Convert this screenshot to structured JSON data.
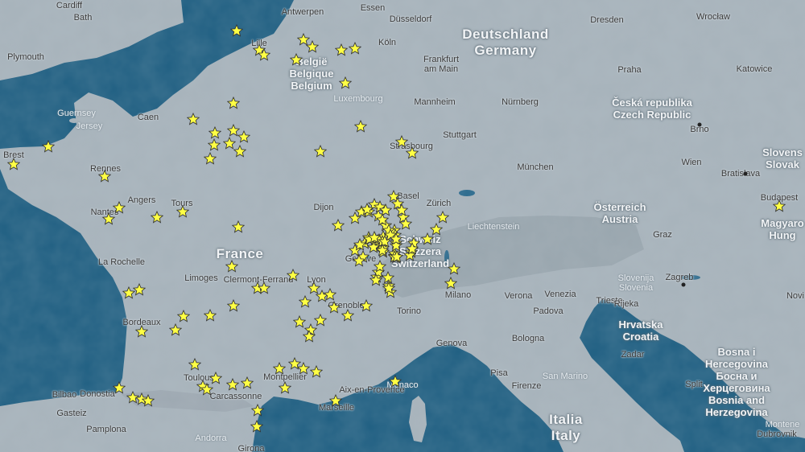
{
  "colors": {
    "sea": "#1f5f82",
    "land": "#a7b3bb",
    "marker": "#ffff44",
    "marker_stroke": "#333333"
  },
  "countries": [
    {
      "id": "germany",
      "lines": [
        "Deutschland",
        "Germany"
      ]
    },
    {
      "id": "france",
      "lines": [
        "France"
      ]
    },
    {
      "id": "belgium",
      "lines": [
        "België",
        "Belgique",
        "Belgium"
      ]
    },
    {
      "id": "czech",
      "lines": [
        "Česká republika",
        "Czech Republic"
      ]
    },
    {
      "id": "austria",
      "lines": [
        "Österreich",
        "Austria"
      ]
    },
    {
      "id": "switzerland",
      "lines": [
        "Schweiz",
        "Svizzera",
        "Switzerland"
      ]
    },
    {
      "id": "italy",
      "lines": [
        "Italia",
        "Italy"
      ]
    },
    {
      "id": "croatia",
      "lines": [
        "Hrvatska",
        "Croatia"
      ]
    },
    {
      "id": "bosnia",
      "lines": [
        "Bosna i",
        "Hercegovina",
        "Босна и",
        "Херцеговина",
        "Bosnia and",
        "Herzegovina"
      ]
    },
    {
      "id": "slovenia",
      "lines": [
        "Slovenija",
        "Slovenia"
      ]
    },
    {
      "id": "slovakia",
      "lines": [
        "Slovens",
        "Slovak"
      ]
    },
    {
      "id": "hungary",
      "lines": [
        "Magyaro",
        "Hung"
      ]
    },
    {
      "id": "luxembourg",
      "lines": [
        "Luxembourg"
      ]
    },
    {
      "id": "liechtenstein",
      "lines": [
        "Liechtenstein"
      ]
    },
    {
      "id": "andorra",
      "lines": [
        "Andorra"
      ]
    },
    {
      "id": "san-marino",
      "lines": [
        "San Marino"
      ]
    },
    {
      "id": "monaco",
      "lines": [
        "Monaco"
      ]
    },
    {
      "id": "montenegro",
      "lines": [
        "Montene"
      ]
    },
    {
      "id": "guernsey",
      "lines": [
        "Guernsey"
      ]
    },
    {
      "id": "jersey",
      "lines": [
        "Jersey"
      ]
    }
  ],
  "cities": [
    "Cardiff",
    "Bath",
    "Plymouth",
    "Antwerpen",
    "Essen",
    "Düsseldorf",
    "Köln",
    "Lille",
    "Dresden",
    "Wrocław",
    "Katowice",
    "Praha",
    "Frankfurt am Main",
    "Mannheim",
    "Nürnberg",
    "Stuttgart",
    "Strasbourg",
    "München",
    "Brno",
    "Wien",
    "Bratislava",
    "Budapest",
    "Caen",
    "Brest",
    "Rennes",
    "Angers",
    "Tours",
    "Nantes",
    "Dijon",
    "Zürich",
    "Basel",
    "La Rochelle",
    "Limoges",
    "Clermont-Ferrand",
    "Lyon",
    "Genève",
    "Grenoble",
    "Milano",
    "Torino",
    "Verona",
    "Venezia",
    "Trieste",
    "Padova",
    "Zagreb",
    "Graz",
    "Bordeaux",
    "Bologna",
    "Genova",
    "Firenze",
    "Pisa",
    "Toulouse",
    "Montpellier",
    "Carcassonne",
    "Aix-en-Provence",
    "Marseille",
    "Bilbao",
    "Donostia",
    "Gasteiz",
    "Pamplona",
    "Girona",
    "Zadar",
    "Split",
    "Dubrovnik",
    "Novi",
    "Rijeka"
  ],
  "markers": 130
}
